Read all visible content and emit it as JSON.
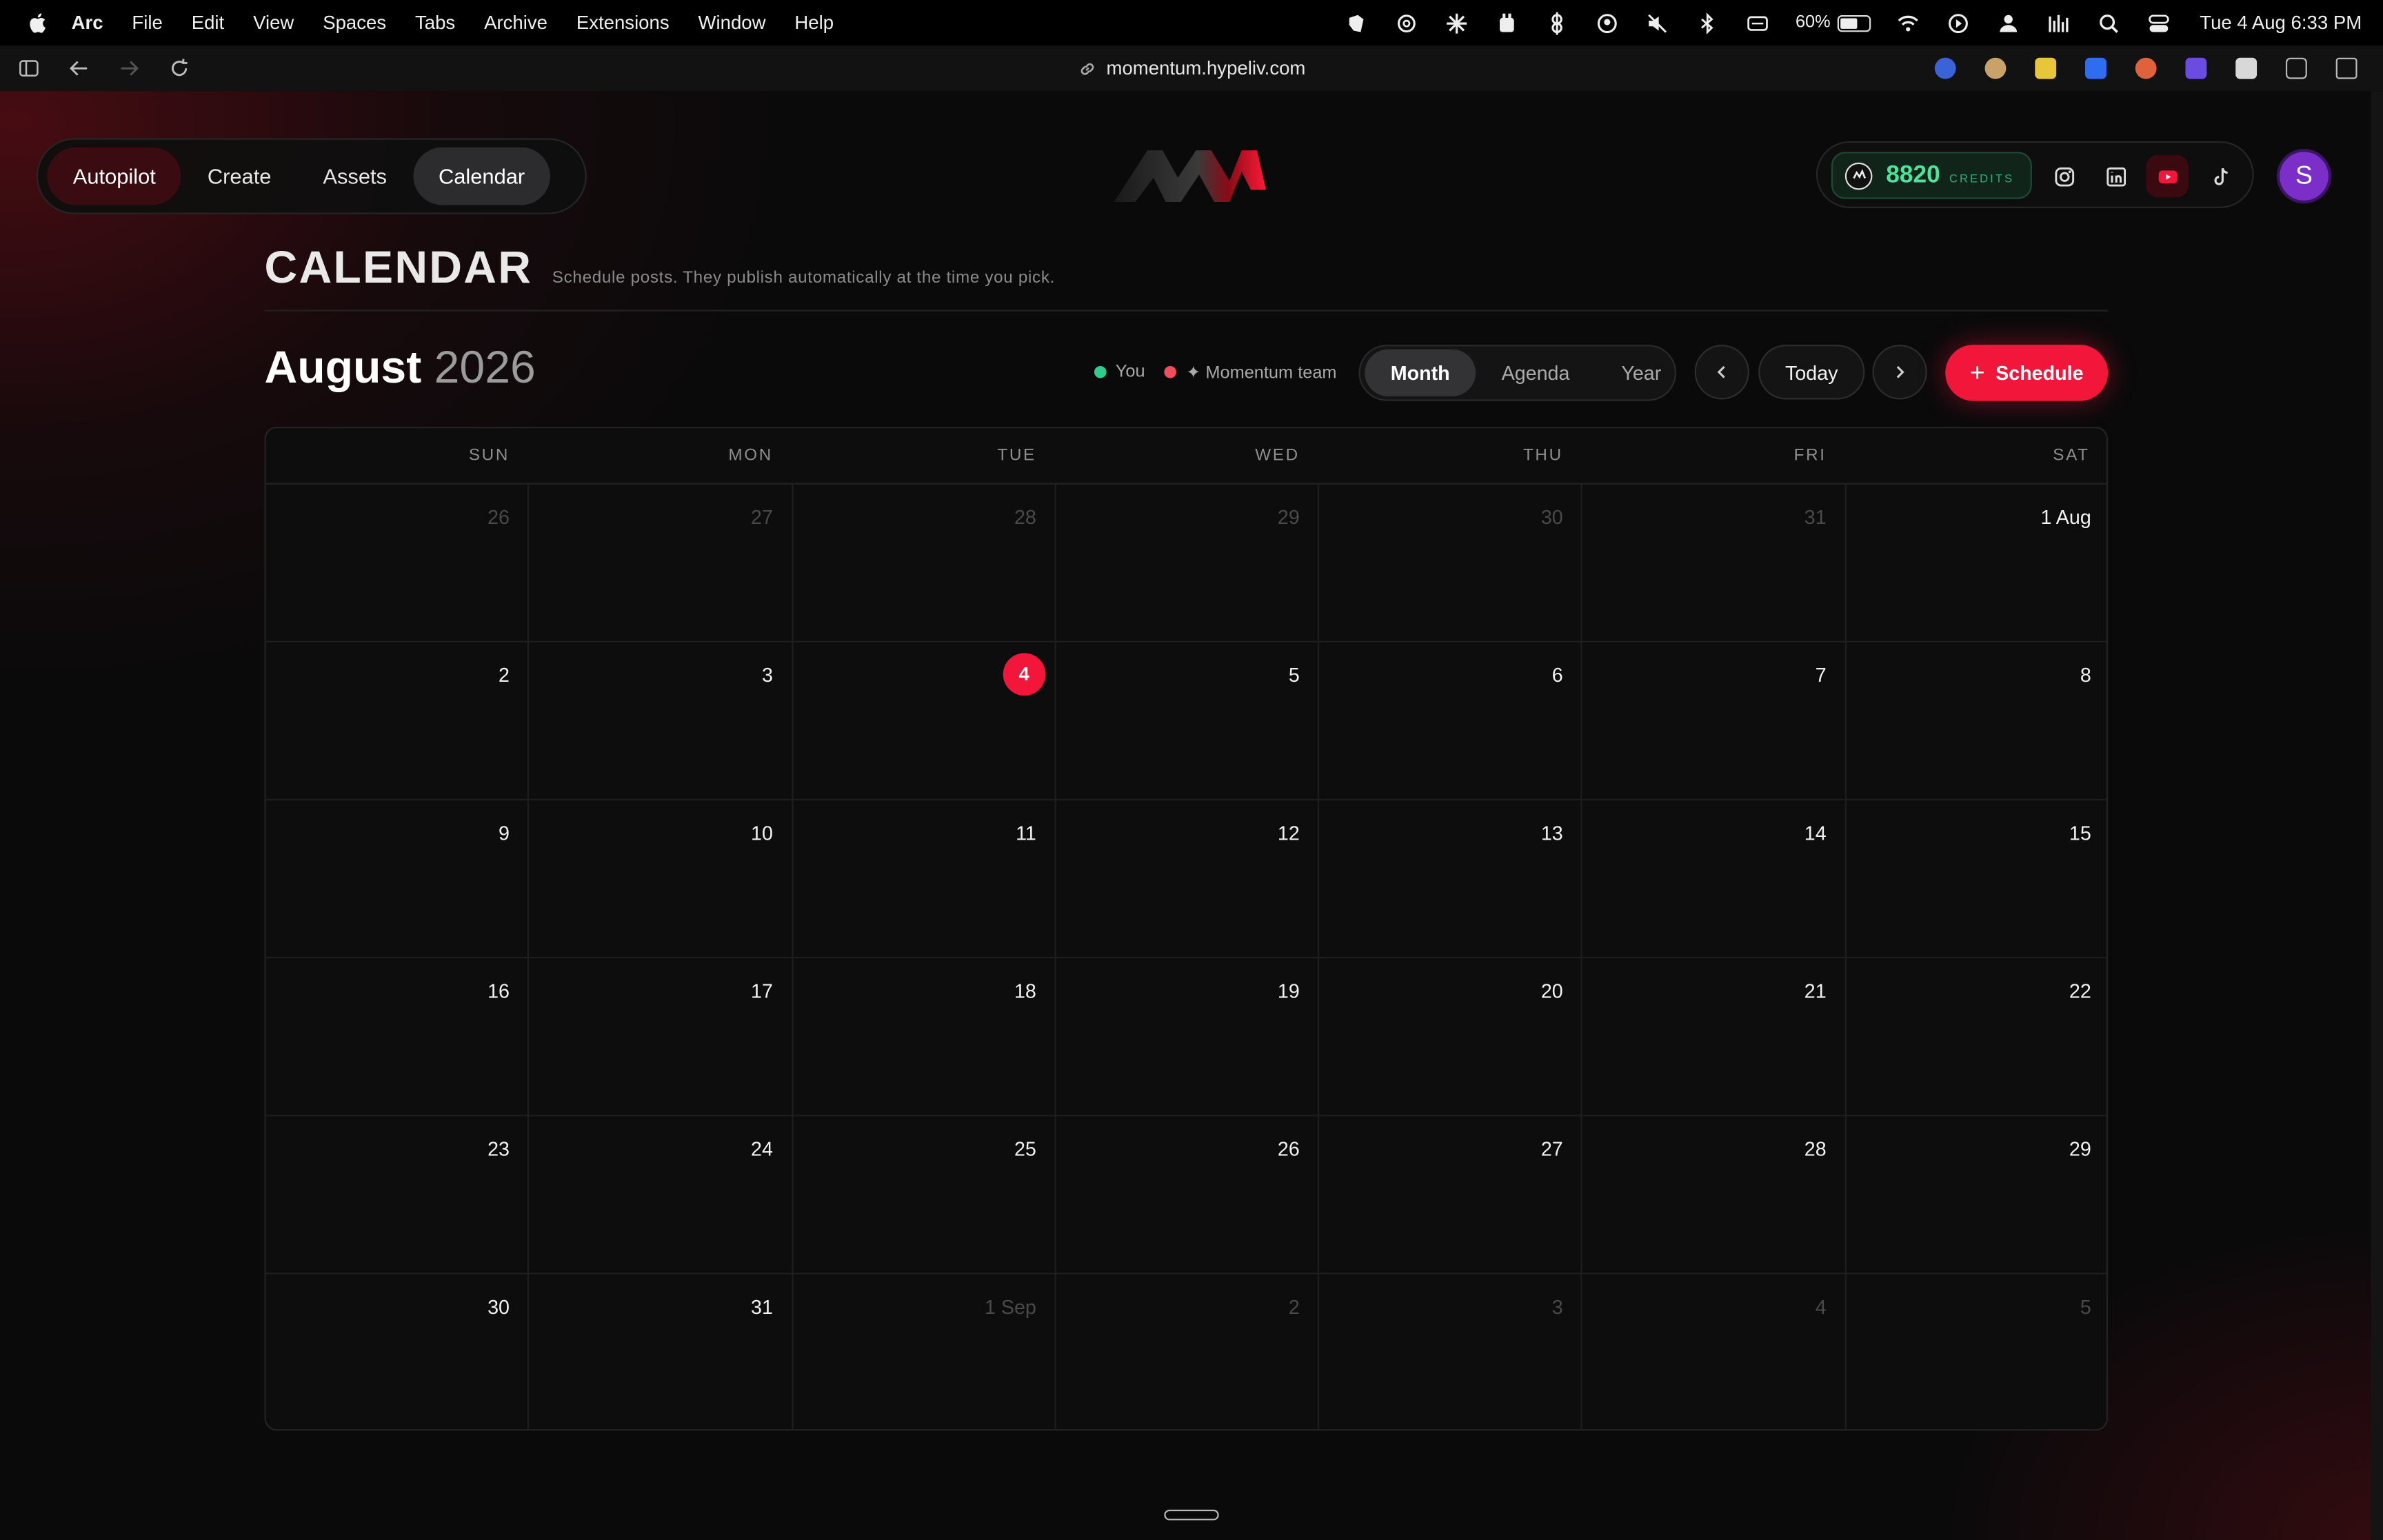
{
  "menubar": {
    "app": "Arc",
    "items": [
      "File",
      "Edit",
      "View",
      "Spaces",
      "Tabs",
      "Archive",
      "Extensions",
      "Window",
      "Help"
    ],
    "battery": "60%",
    "battery_level": 0.6,
    "clock": "Tue 4 Aug  6:33 PM"
  },
  "browser": {
    "url": "momentum.hypeliv.com"
  },
  "nav": {
    "tabs": [
      {
        "label": "Autopilot"
      },
      {
        "label": "Create"
      },
      {
        "label": "Assets"
      },
      {
        "label": "Calendar"
      }
    ]
  },
  "credits": {
    "value": "8820",
    "label": "CREDITS"
  },
  "user": {
    "initial": "S",
    "avatar_color": "#7c2fc8"
  },
  "header": {
    "title": "CALENDAR",
    "subtitle": "Schedule posts. They publish automatically at the time you pick."
  },
  "calendar": {
    "month": "August",
    "year": "2026",
    "legend": [
      {
        "label": "You",
        "color": "#2ecc8f"
      },
      {
        "label": "✦ Momentum team",
        "color": "#f24d5e"
      }
    ],
    "views": [
      "Month",
      "Agenda",
      "Year"
    ],
    "active_view": "Month",
    "today_label": "Today",
    "schedule_label": "Schedule",
    "weekdays": [
      "SUN",
      "MON",
      "TUE",
      "WED",
      "THU",
      "FRI",
      "SAT"
    ],
    "weeks": [
      [
        {
          "d": "26",
          "o": true
        },
        {
          "d": "27",
          "o": true
        },
        {
          "d": "28",
          "o": true
        },
        {
          "d": "29",
          "o": true
        },
        {
          "d": "30",
          "o": true
        },
        {
          "d": "31",
          "o": true
        },
        {
          "d": "1 Aug",
          "o": false
        }
      ],
      [
        {
          "d": "2",
          "o": false
        },
        {
          "d": "3",
          "o": false
        },
        {
          "d": "4",
          "o": false,
          "t": true
        },
        {
          "d": "5",
          "o": false
        },
        {
          "d": "6",
          "o": false
        },
        {
          "d": "7",
          "o": false
        },
        {
          "d": "8",
          "o": false
        }
      ],
      [
        {
          "d": "9",
          "o": false
        },
        {
          "d": "10",
          "o": false
        },
        {
          "d": "11",
          "o": false
        },
        {
          "d": "12",
          "o": false
        },
        {
          "d": "13",
          "o": false
        },
        {
          "d": "14",
          "o": false
        },
        {
          "d": "15",
          "o": false
        }
      ],
      [
        {
          "d": "16",
          "o": false
        },
        {
          "d": "17",
          "o": false
        },
        {
          "d": "18",
          "o": false
        },
        {
          "d": "19",
          "o": false
        },
        {
          "d": "20",
          "o": false
        },
        {
          "d": "21",
          "o": false
        },
        {
          "d": "22",
          "o": false
        }
      ],
      [
        {
          "d": "23",
          "o": false
        },
        {
          "d": "24",
          "o": false
        },
        {
          "d": "25",
          "o": false
        },
        {
          "d": "26",
          "o": false
        },
        {
          "d": "27",
          "o": false
        },
        {
          "d": "28",
          "o": false
        },
        {
          "d": "29",
          "o": false
        }
      ],
      [
        {
          "d": "30",
          "o": false
        },
        {
          "d": "31",
          "o": false
        },
        {
          "d": "1 Sep",
          "o": true
        },
        {
          "d": "2",
          "o": true
        },
        {
          "d": "3",
          "o": true
        },
        {
          "d": "4",
          "o": true
        },
        {
          "d": "5",
          "o": true
        }
      ]
    ]
  },
  "colors": {
    "accent": "#f2173a",
    "credits_green": "#4ee39a"
  }
}
